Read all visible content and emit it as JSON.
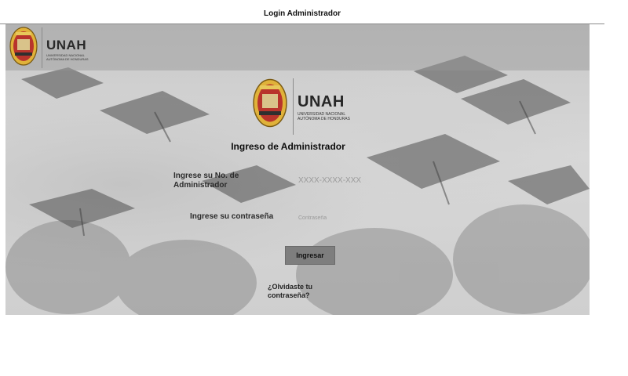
{
  "window": {
    "title": "Login Administrador"
  },
  "header": {
    "brand": "UNAH",
    "brand_subtitle": "Universidad Nacional Autónoma de Honduras"
  },
  "main": {
    "brand": "UNAH",
    "brand_subtitle": "Universidad Nacional Autónoma de Honduras",
    "form_title": "Ingreso de Administrador",
    "admin_id_label": "Ingrese su No. de Administrador",
    "admin_id_placeholder": "XXXX-XXXX-XXX",
    "admin_id_value": "",
    "password_label": "Ingrese su contraseña",
    "password_placeholder": "Contraseña",
    "password_value": "",
    "login_button": "Ingresar",
    "forgot_link": "¿Olvidaste tu contraseña?"
  },
  "icons": {
    "logo": "unah-seal-icon",
    "background": "graduation-caps-photo"
  },
  "colors": {
    "button_bg": "#7e7e7e",
    "seal_gold": "#e0b23a",
    "seal_red": "#b8342c"
  }
}
